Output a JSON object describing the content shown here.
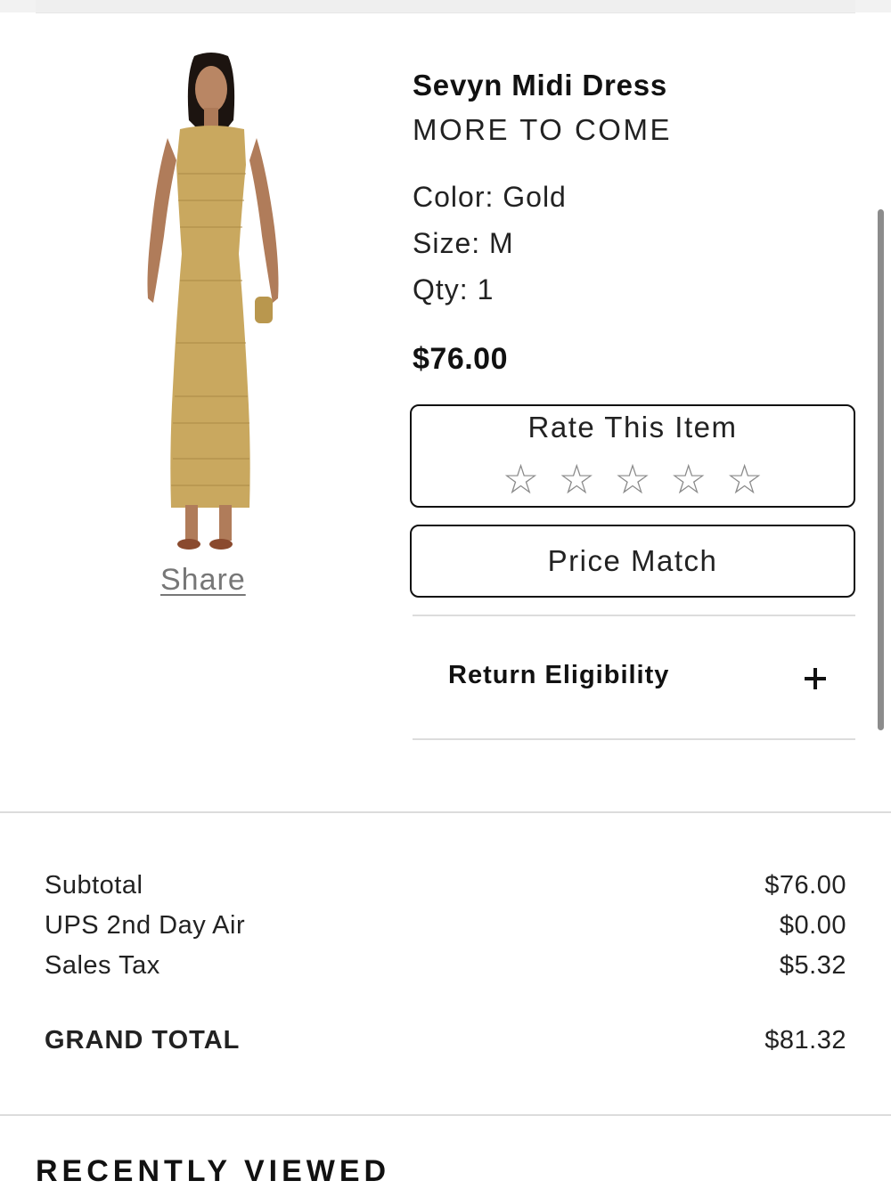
{
  "product": {
    "title": "Sevyn Midi Dress",
    "brand": "MORE TO COME",
    "color": "Color: Gold",
    "size": "Size: M",
    "qty": "Qty: 1",
    "price": "$76.00",
    "image_icon": "dress-model-image"
  },
  "share": {
    "label": "Share"
  },
  "rating": {
    "title": "Rate This Item",
    "stars": [
      "☆",
      "☆",
      "☆",
      "☆",
      "☆"
    ]
  },
  "price_match": {
    "label": "Price Match"
  },
  "return_eligibility": {
    "label": "Return Eligibility",
    "icon": "plus-icon"
  },
  "summary": {
    "subtotal_label": "Subtotal",
    "subtotal_value": "$76.00",
    "shipping_label": "UPS 2nd Day Air",
    "shipping_value": "$0.00",
    "tax_label": "Sales Tax",
    "tax_value": "$5.32",
    "grand_total_label": "GRAND TOTAL",
    "grand_total_value": "$81.32"
  },
  "recently_viewed": {
    "title": "RECENTLY VIEWED"
  },
  "colors": {
    "dress": "#c9a85f",
    "text": "#111111",
    "muted": "#777777",
    "border": "#dcdcdc"
  }
}
